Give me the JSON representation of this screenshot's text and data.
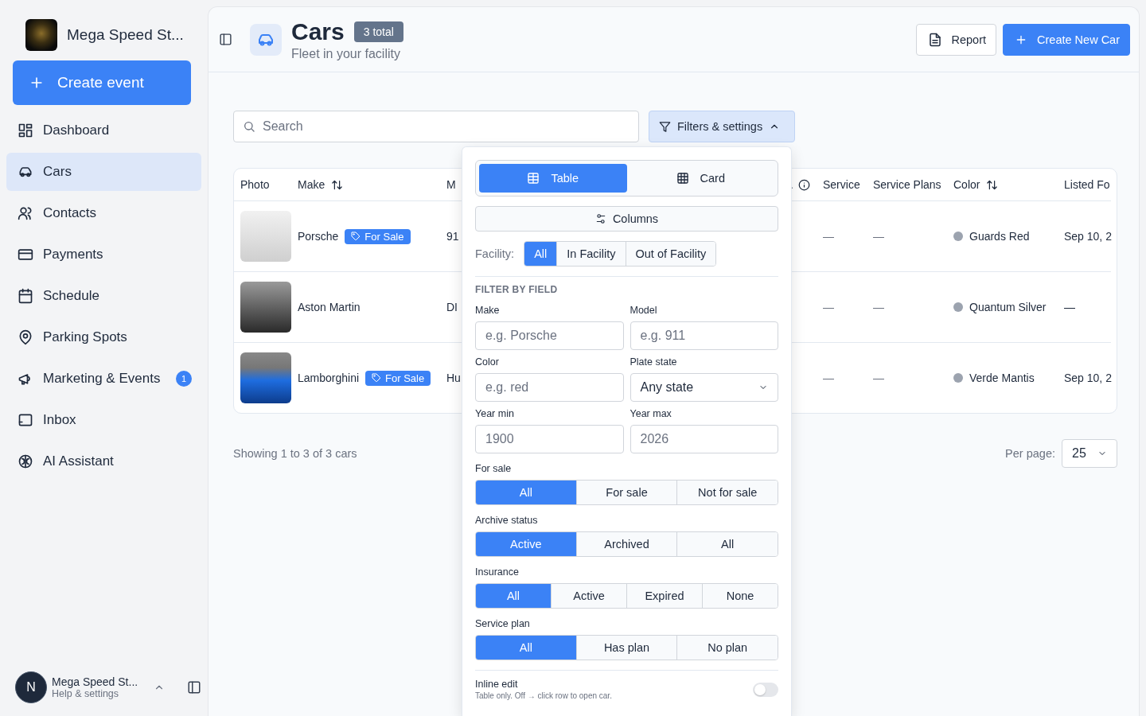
{
  "sidebar": {
    "brand": "Mega Speed St...",
    "create_button": "Create event",
    "items": [
      {
        "label": "Dashboard",
        "selected": false
      },
      {
        "label": "Cars",
        "selected": true
      },
      {
        "label": "Contacts",
        "selected": false
      },
      {
        "label": "Payments",
        "selected": false
      },
      {
        "label": "Schedule",
        "selected": false
      },
      {
        "label": "Parking Spots",
        "selected": false
      },
      {
        "label": "Marketing & Events",
        "selected": false,
        "badge": "1"
      },
      {
        "label": "Inbox",
        "selected": false
      },
      {
        "label": "AI Assistant",
        "selected": false
      }
    ],
    "user": {
      "initial": "N",
      "name": "Mega Speed St...",
      "subtitle": "Help & settings"
    }
  },
  "header": {
    "title": "Cars",
    "count_badge": "3 total",
    "subtitle": "Fleet in your facility",
    "buttons": [
      {
        "label": "Report",
        "kind": "outline"
      },
      {
        "label": "Create New Car",
        "kind": "primary"
      }
    ]
  },
  "toolbar": {
    "search": {
      "placeholder": "Search"
    },
    "filters_button": {
      "label": "Filters & settings",
      "expanded": true
    }
  },
  "table": {
    "columns": [
      {
        "label": "Photo",
        "kind": "plain"
      },
      {
        "label": "Make",
        "kind": "sortable"
      },
      {
        "label": "M",
        "kind": "plain"
      },
      {
        "label": ".",
        "kind": "info"
      },
      {
        "label": "Service",
        "kind": "plain"
      },
      {
        "label": "Service Plans",
        "kind": "plain"
      },
      {
        "label": "Color",
        "kind": "sortable"
      },
      {
        "label": "Listed Fo",
        "kind": "plain"
      }
    ],
    "rows": [
      {
        "make": "Porsche",
        "tag": "For Sale",
        "column_3": "91",
        "service": "—",
        "service_plans": "—",
        "color_name": "Guards Red",
        "listed": "Sep 10, 2"
      },
      {
        "make": "Aston Martin",
        "column_3": "DI",
        "service": "—",
        "service_plans": "—",
        "color_name": "Quantum Silver",
        "listed": "—"
      },
      {
        "make": "Lamborghini",
        "tag": "For Sale",
        "column_3": "Hu",
        "service": "—",
        "service_plans": "—",
        "color_name": "Verde Mantis",
        "listed": "Sep 10, 2"
      }
    ]
  },
  "footer": {
    "summary": "Showing 1 to 3 of 3 cars",
    "per_page_label": "Per page:",
    "per_page": "25"
  },
  "filters_popover": {
    "view_options": [
      {
        "label": "Table",
        "selected": true
      },
      {
        "label": "Card",
        "selected": false
      }
    ],
    "columns_button": "Columns",
    "facility": {
      "label": "Facility:",
      "options": [
        {
          "label": "All",
          "selected": true
        },
        {
          "label": "In Facility",
          "selected": false
        },
        {
          "label": "Out of Facility",
          "selected": false
        }
      ]
    },
    "section_title": "FILTER BY FIELD",
    "fields": [
      {
        "label": "Make",
        "kind": "text",
        "placeholder": "e.g. Porsche"
      },
      {
        "label": "Model",
        "kind": "text",
        "placeholder": "e.g. 911"
      },
      {
        "label": "Color",
        "kind": "text",
        "placeholder": "e.g. red"
      },
      {
        "label": "Plate state",
        "kind": "select",
        "value": "Any state"
      },
      {
        "label": "Year min",
        "kind": "text",
        "placeholder": "1900"
      },
      {
        "label": "Year max",
        "kind": "text",
        "placeholder": "2026"
      }
    ],
    "groups": [
      {
        "label": "For sale",
        "options": [
          {
            "label": "All",
            "selected": true
          },
          {
            "label": "For sale",
            "selected": false
          },
          {
            "label": "Not for sale",
            "selected": false
          }
        ]
      },
      {
        "label": "Archive status",
        "options": [
          {
            "label": "Active",
            "selected": true
          },
          {
            "label": "Archived",
            "selected": false
          },
          {
            "label": "All",
            "selected": false
          }
        ]
      },
      {
        "label": "Insurance",
        "options": [
          {
            "label": "All",
            "selected": true
          },
          {
            "label": "Active",
            "selected": false
          },
          {
            "label": "Expired",
            "selected": false
          },
          {
            "label": "None",
            "selected": false
          }
        ]
      },
      {
        "label": "Service plan",
        "options": [
          {
            "label": "All",
            "selected": true
          },
          {
            "label": "Has plan",
            "selected": false
          },
          {
            "label": "No plan",
            "selected": false
          }
        ]
      }
    ],
    "inline_edit": {
      "label": "Inline edit",
      "hint": "Table only. Off → click row to open car.",
      "on": false
    }
  }
}
